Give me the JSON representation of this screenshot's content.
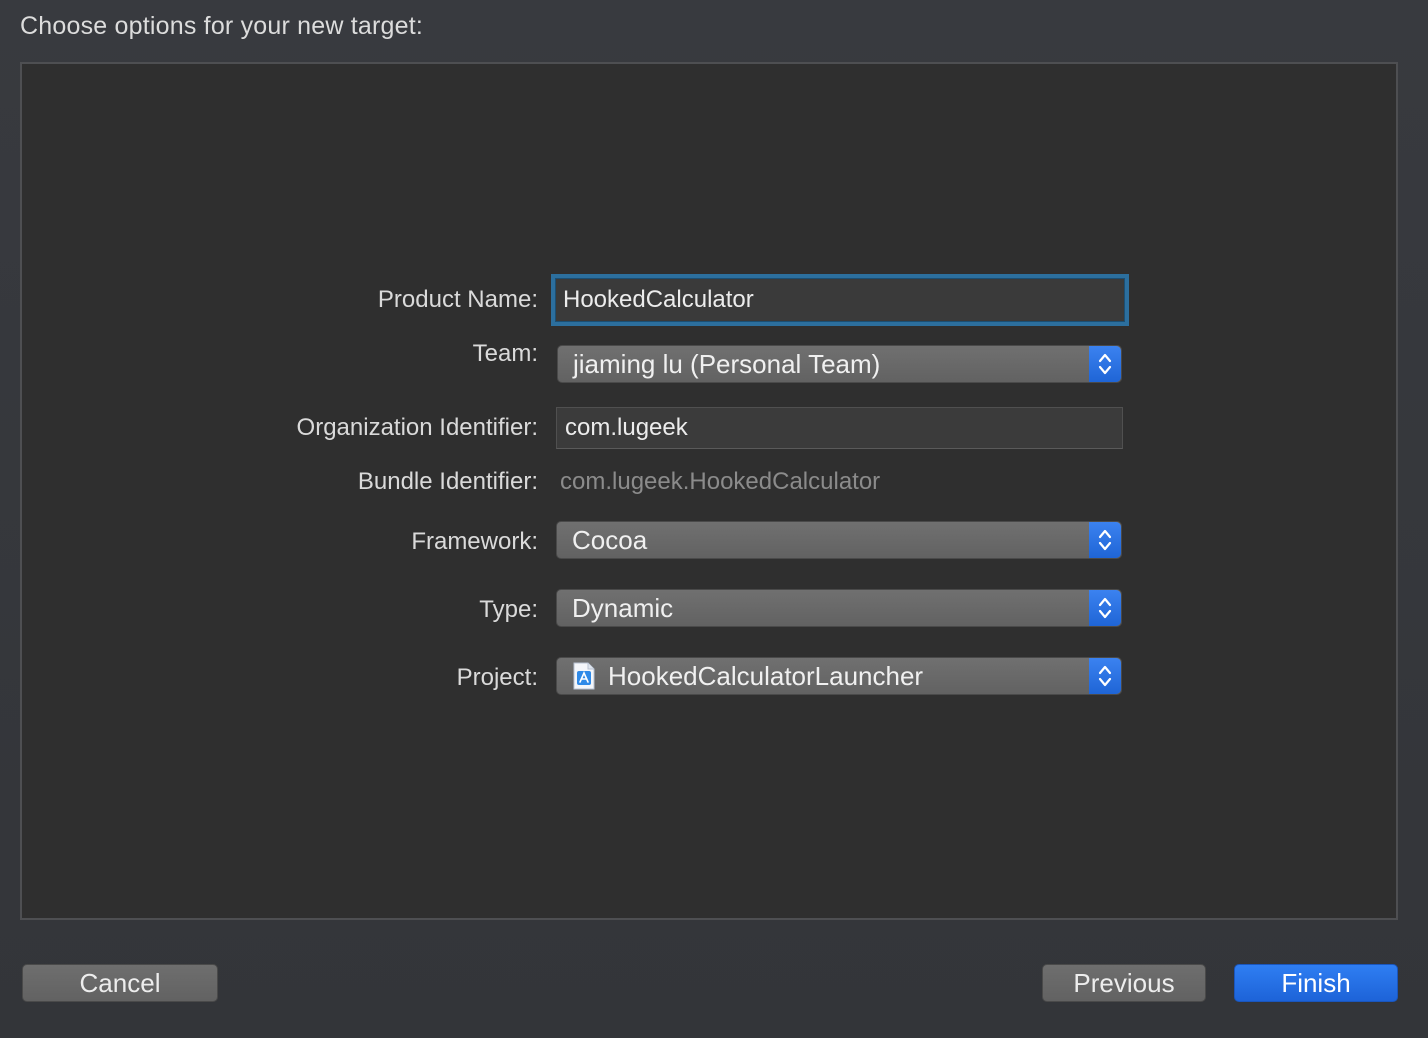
{
  "sheet": {
    "title": "Choose options for your new target:"
  },
  "form": {
    "product_name": {
      "label": "Product Name:",
      "value": "HookedCalculator"
    },
    "team": {
      "label": "Team:",
      "selected": "jiaming lu (Personal Team)"
    },
    "organization_identifier": {
      "label": "Organization Identifier:",
      "value": "com.lugeek"
    },
    "bundle_identifier": {
      "label": "Bundle Identifier:",
      "value": "com.lugeek.HookedCalculator"
    },
    "framework": {
      "label": "Framework:",
      "selected": "Cocoa"
    },
    "type": {
      "label": "Type:",
      "selected": "Dynamic"
    },
    "project": {
      "label": "Project:",
      "selected": "HookedCalculatorLauncher",
      "icon": "xcode-project-icon"
    }
  },
  "buttons": {
    "cancel": "Cancel",
    "previous": "Previous",
    "finish": "Finish"
  },
  "colors": {
    "accent": "#1f65d6",
    "focus_ring": "#2c6f9e"
  }
}
